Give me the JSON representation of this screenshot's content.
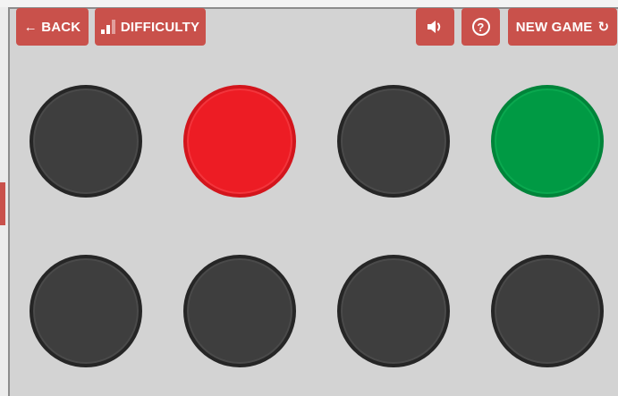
{
  "toolbar": {
    "back_label": "← BACK",
    "difficulty_label": "DIFFICULTY",
    "help_symbol": "?",
    "new_game_label": "NEW GAME",
    "new_game_symbol": "↻",
    "sound_icon": "speaker-icon",
    "difficulty_icon": "signal-bars-icon",
    "difficulty_level": "2 of 3"
  },
  "board": {
    "rows": 2,
    "columns": 4,
    "lights": [
      {
        "row": 1,
        "col": 1,
        "state": "off"
      },
      {
        "row": 1,
        "col": 2,
        "state": "red"
      },
      {
        "row": 1,
        "col": 3,
        "state": "off"
      },
      {
        "row": 1,
        "col": 4,
        "state": "green"
      },
      {
        "row": 2,
        "col": 1,
        "state": "off"
      },
      {
        "row": 2,
        "col": 2,
        "state": "off"
      },
      {
        "row": 2,
        "col": 3,
        "state": "off"
      },
      {
        "row": 2,
        "col": 4,
        "state": "off"
      }
    ]
  },
  "colors": {
    "button": "#c9514b",
    "panel": "#d3d3d3",
    "light_off": "#3e3e3e",
    "light_red": "#ed1c24",
    "light_green": "#009a44"
  }
}
